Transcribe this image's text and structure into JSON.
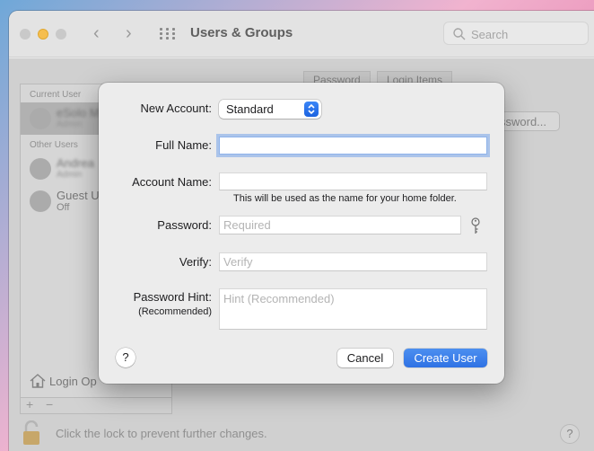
{
  "window": {
    "title": "Users & Groups",
    "search_placeholder": "Search"
  },
  "background": {
    "list_header_current": "Current User",
    "list_header_other": "Other Users",
    "current_user_name": "eSolo M",
    "current_user_role": "Admin",
    "other_user_name": "Andrea",
    "other_user_role": "Admin",
    "guest_name": "Guest U",
    "guest_status": "Off",
    "login_options": "Login Op",
    "tab_password": "Password",
    "tab_login_items": "Login Items",
    "change_password_button": "ssword...",
    "lock_text": "Click the lock to prevent further changes.",
    "help": "?",
    "plus": "+",
    "minus": "−"
  },
  "sheet": {
    "new_account_label": "New Account:",
    "new_account_value": "Standard",
    "full_name_label": "Full Name:",
    "full_name_value": "",
    "account_name_label": "Account Name:",
    "account_name_value": "",
    "account_name_note": "This will be used as the name for your home folder.",
    "password_label": "Password:",
    "password_placeholder": "Required",
    "verify_label": "Verify:",
    "verify_placeholder": "Verify",
    "hint_label": "Password Hint:",
    "hint_label_sub": "(Recommended)",
    "hint_placeholder": "Hint (Recommended)",
    "help": "?",
    "cancel": "Cancel",
    "create": "Create User"
  },
  "colors": {
    "accent": "#2f72e4",
    "minimize_light": "#f5be4f"
  }
}
